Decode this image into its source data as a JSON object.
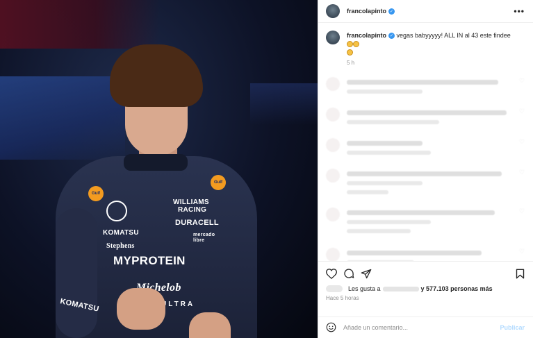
{
  "photo": {
    "suit_logos": {
      "williams": "WILLIAMS",
      "racing": "RACING",
      "duracell": "DURACELL",
      "komatsu": "KOMATSU",
      "stephens": "Stephens",
      "mercado": "mercado",
      "libre": "libre",
      "myprotein": "MYPROTEIN",
      "michelob": "Michelob",
      "ultra": "ULTRA",
      "gulf": "Gulf",
      "komatsu_sleeve": "KOMATSU"
    }
  },
  "header": {
    "username": "francolapinto",
    "more_label": "•••"
  },
  "caption": {
    "username": "francolapinto",
    "text": "vegas babyyyyy! ALL IN al 43 este findee",
    "time": "5 h"
  },
  "comments_blurred": 6,
  "actions": {
    "likes_prefix": "Les gusta a",
    "likes_suffix": "y 577.103 personas más",
    "time_ago": "Hace 5 horas"
  },
  "add_comment": {
    "placeholder": "Añade un comentario...",
    "publish_label": "Publicar"
  },
  "colors": {
    "verified": "#3897f0",
    "publish": "#b3dbff",
    "meta": "#8e8e8e"
  }
}
